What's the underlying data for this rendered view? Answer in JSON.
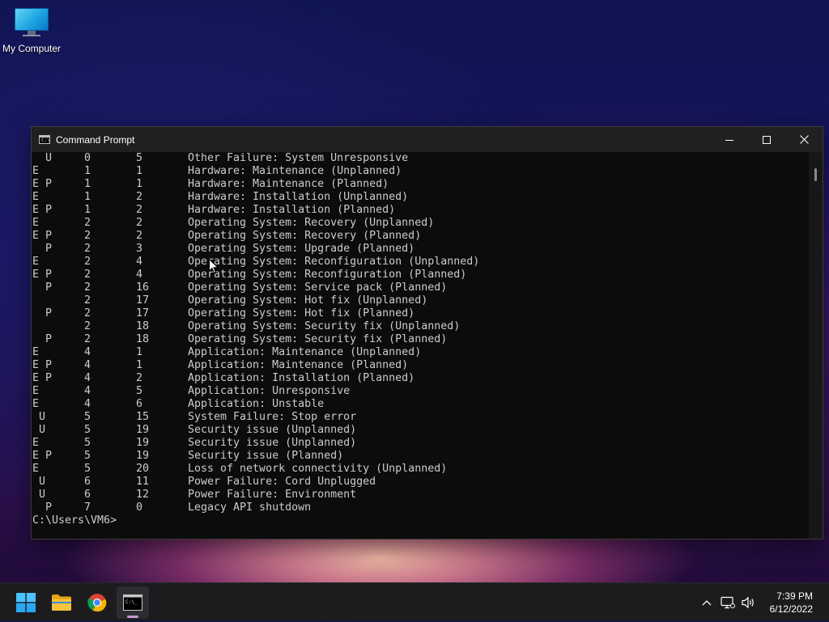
{
  "desktop": {
    "icons": [
      {
        "label": "My Computer",
        "icon": "computer-icon"
      }
    ]
  },
  "window": {
    "title": "Command Prompt",
    "icon": "cmd-icon",
    "controls": [
      "minimize-icon",
      "maximize-icon",
      "close-icon"
    ]
  },
  "console": {
    "rows": [
      [
        "  U",
        "0",
        "5",
        "Other Failure: System Unresponsive"
      ],
      [
        "E",
        "1",
        "1",
        "Hardware: Maintenance (Unplanned)"
      ],
      [
        "E P",
        "1",
        "1",
        "Hardware: Maintenance (Planned)"
      ],
      [
        "E",
        "1",
        "2",
        "Hardware: Installation (Unplanned)"
      ],
      [
        "E P",
        "1",
        "2",
        "Hardware: Installation (Planned)"
      ],
      [
        "E",
        "2",
        "2",
        "Operating System: Recovery (Unplanned)"
      ],
      [
        "E P",
        "2",
        "2",
        "Operating System: Recovery (Planned)"
      ],
      [
        "  P",
        "2",
        "3",
        "Operating System: Upgrade (Planned)"
      ],
      [
        "E",
        "2",
        "4",
        "Operating System: Reconfiguration (Unplanned)"
      ],
      [
        "E P",
        "2",
        "4",
        "Operating System: Reconfiguration (Planned)"
      ],
      [
        "  P",
        "2",
        "16",
        "Operating System: Service pack (Planned)"
      ],
      [
        "",
        "2",
        "17",
        "Operating System: Hot fix (Unplanned)"
      ],
      [
        "  P",
        "2",
        "17",
        "Operating System: Hot fix (Planned)"
      ],
      [
        "",
        "2",
        "18",
        "Operating System: Security fix (Unplanned)"
      ],
      [
        "  P",
        "2",
        "18",
        "Operating System: Security fix (Planned)"
      ],
      [
        "E",
        "4",
        "1",
        "Application: Maintenance (Unplanned)"
      ],
      [
        "E P",
        "4",
        "1",
        "Application: Maintenance (Planned)"
      ],
      [
        "E P",
        "4",
        "2",
        "Application: Installation (Planned)"
      ],
      [
        "E",
        "4",
        "5",
        "Application: Unresponsive"
      ],
      [
        "E",
        "4",
        "6",
        "Application: Unstable"
      ],
      [
        " U",
        "5",
        "15",
        "System Failure: Stop error"
      ],
      [
        " U",
        "5",
        "19",
        "Security issue (Unplanned)"
      ],
      [
        "E",
        "5",
        "19",
        "Security issue (Unplanned)"
      ],
      [
        "E P",
        "5",
        "19",
        "Security issue (Planned)"
      ],
      [
        "E",
        "5",
        "20",
        "Loss of network connectivity (Unplanned)"
      ],
      [
        " U",
        "6",
        "11",
        "Power Failure: Cord Unplugged"
      ],
      [
        " U",
        "6",
        "12",
        "Power Failure: Environment"
      ],
      [
        "  P",
        "7",
        "0",
        "Legacy API shutdown"
      ]
    ],
    "prompt": "C:\\Users\\VM6>"
  },
  "taskbar": {
    "apps": [
      {
        "name": "start-button",
        "icon": "windows-logo-icon"
      },
      {
        "name": "file-explorer",
        "icon": "folder-icon"
      },
      {
        "name": "chrome",
        "icon": "chrome-icon"
      },
      {
        "name": "command-prompt",
        "icon": "cmd-icon",
        "active": true
      }
    ],
    "tray": {
      "icons": [
        "chevron-up-icon",
        "network-icon",
        "volume-icon"
      ],
      "time": "7:39 PM",
      "date": "6/12/2022"
    }
  }
}
